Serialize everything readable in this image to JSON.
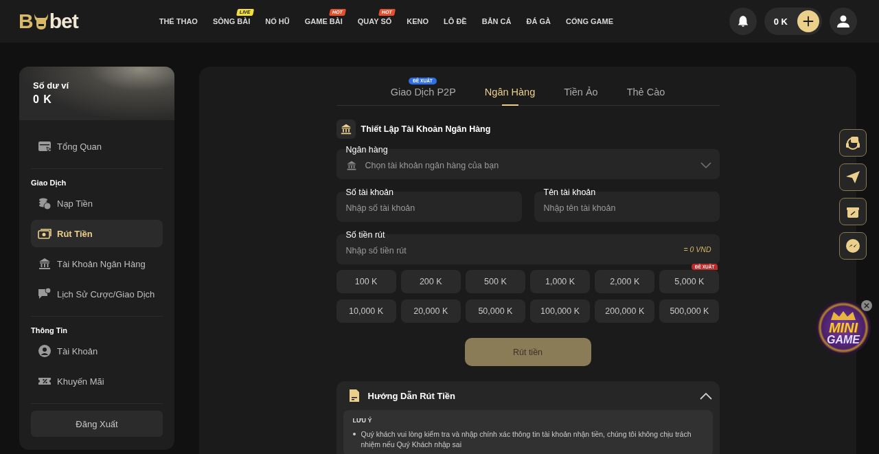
{
  "header": {
    "logo": {
      "left": "B",
      "right": "bet"
    },
    "nav": [
      {
        "label": "THỂ THAO"
      },
      {
        "label": "SÒNG BÀI",
        "badge": {
          "text": "LIVE",
          "kind": "live"
        }
      },
      {
        "label": "NỔ HŨ"
      },
      {
        "label": "GAME BÀI",
        "badge": {
          "text": "HOT",
          "kind": "hot"
        }
      },
      {
        "label": "QUAY SỐ",
        "badge": {
          "text": "HOT",
          "kind": "hot"
        }
      },
      {
        "label": "KENO"
      },
      {
        "label": "LÔ ĐỀ"
      },
      {
        "label": "BẮN CÁ"
      },
      {
        "label": "ĐÁ GÀ"
      },
      {
        "label": "CỔNG GAME"
      }
    ],
    "balance": "0 K"
  },
  "sidebar": {
    "wallet_label": "Số dư ví",
    "wallet_amount": "0 K",
    "sections": [
      {
        "items": [
          {
            "label": "Tổng Quan",
            "selected": false
          }
        ]
      },
      {
        "title": "Giao Dịch",
        "items": [
          {
            "label": "Nạp Tiền",
            "selected": false
          },
          {
            "label": "Rút Tiền",
            "selected": true
          },
          {
            "label": "Tài Khoản Ngân Hàng",
            "selected": false
          },
          {
            "label": "Lịch Sử Cược/Giao Dịch",
            "selected": false
          }
        ]
      },
      {
        "title": "Thông Tin",
        "items": [
          {
            "label": "Tài Khoản",
            "selected": false
          },
          {
            "label": "Khuyến Mãi",
            "selected": false
          }
        ]
      }
    ],
    "logout": "Đăng Xuất"
  },
  "tabs": [
    {
      "label": "Giao Dịch P2P",
      "selected": false,
      "badge": "ĐỀ XUẤT"
    },
    {
      "label": "Ngân Hàng",
      "selected": true
    },
    {
      "label": "Tiền Ảo",
      "selected": false
    },
    {
      "label": "Thẻ Cào",
      "selected": false
    }
  ],
  "form": {
    "title": "Thiết Lập Tài Khoản Ngân Hàng",
    "bank": {
      "label": "Ngân hàng",
      "placeholder": "Chọn tài khoản ngân hàng của bạn"
    },
    "account_number": {
      "label": "Số tài khoản",
      "placeholder": "Nhập số tài khoản"
    },
    "account_name": {
      "label": "Tên tài khoản",
      "placeholder": "Nhập tên tài khoản"
    },
    "amount": {
      "label": "Số tiền rút",
      "placeholder": "Nhập số tiền rút",
      "conversion": "= 0 VND"
    },
    "quick_amounts": [
      {
        "label": "100 K"
      },
      {
        "label": "200 K"
      },
      {
        "label": "500 K"
      },
      {
        "label": "1,000 K"
      },
      {
        "label": "2,000 K"
      },
      {
        "label": "5,000 K",
        "badge": "ĐỀ XUẤT"
      },
      {
        "label": "10,000 K"
      },
      {
        "label": "20,000 K"
      },
      {
        "label": "50,000 K"
      },
      {
        "label": "100,000 K"
      },
      {
        "label": "200,000 K"
      },
      {
        "label": "500,000 K"
      }
    ],
    "submit": "Rút tiền"
  },
  "guide": {
    "title": "Hướng Dẫn Rút Tiền",
    "expanded": true,
    "note_title": "LƯU Ý",
    "notes": [
      "Quý khách vui lòng kiểm tra và nhập chính xác thông tin tài khoản nhận tiền, chúng tôi không chịu trách nhiệm nếu Quý Khách nhập sai"
    ]
  },
  "minigame": {
    "line1": "MINI",
    "line2": "GAME"
  }
}
